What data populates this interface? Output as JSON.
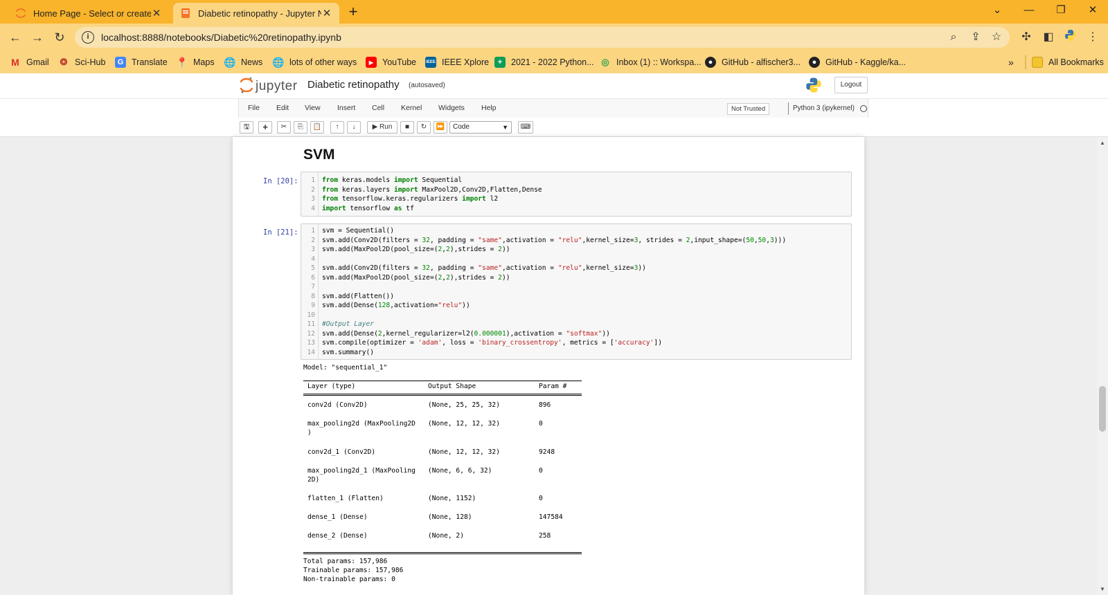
{
  "browser": {
    "tabs": [
      {
        "title": "Home Page - Select or create a n",
        "close": "✕"
      },
      {
        "title": "Diabetic retinopathy - Jupyter N",
        "close": "✕"
      }
    ],
    "new_tab": "+",
    "url": "localhost:8888/notebooks/Diabetic%20retinopathy.ipynb",
    "bookmarks": [
      {
        "label": "Gmail"
      },
      {
        "label": "Sci-Hub"
      },
      {
        "label": "Translate"
      },
      {
        "label": "Maps"
      },
      {
        "label": "News"
      },
      {
        "label": "lots of other ways"
      },
      {
        "label": "YouTube"
      },
      {
        "label": "IEEE Xplore"
      },
      {
        "label": "2021 - 2022 Python..."
      },
      {
        "label": "Inbox (1) :: Workspa..."
      },
      {
        "label": "GitHub - alfischer3..."
      },
      {
        "label": "GitHub - Kaggle/ka..."
      }
    ],
    "more_bookmarks": "»",
    "all_bookmarks": "All Bookmarks"
  },
  "jupyter": {
    "logo_text": "jupyter",
    "notebook_name": "Diabetic retinopathy",
    "autosave": "(autosaved)",
    "logout": "Logout",
    "menu": [
      "File",
      "Edit",
      "View",
      "Insert",
      "Cell",
      "Kernel",
      "Widgets",
      "Help"
    ],
    "trust": "Not Trusted",
    "kernel": "Python 3 (ipykernel)",
    "toolbar": {
      "run": "▶ Run",
      "cell_type": "Code"
    }
  },
  "notebook": {
    "heading": "SVM",
    "cell1": {
      "prompt": "In [20]:",
      "lines": [
        "from keras.models import Sequential",
        "from keras.layers import MaxPool2D,Conv2D,Flatten,Dense",
        "from tensorflow.keras.regularizers import l2",
        "import tensorflow as tf"
      ]
    },
    "cell2": {
      "prompt": "In [21]:",
      "lines": [
        "svm = Sequential()",
        "svm.add(Conv2D(filters = 32, padding = \"same\",activation = \"relu\",kernel_size=3, strides = 2,input_shape=(50,50,3)))",
        "svm.add(MaxPool2D(pool_size=(2,2),strides = 2))",
        "",
        "svm.add(Conv2D(filters = 32, padding = \"same\",activation = \"relu\",kernel_size=3))",
        "svm.add(MaxPool2D(pool_size=(2,2),strides = 2))",
        "",
        "svm.add(Flatten())",
        "svm.add(Dense(128,activation=\"relu\"))",
        "",
        "#Output Layer",
        "svm.add(Dense(2,kernel_regularizer=l2(0.000001),activation = \"softmax\"))",
        "svm.compile(optimizer = 'adam', loss = 'binary_crossentropy', metrics = ['accuracy'])",
        "svm.summary()"
      ]
    },
    "output": {
      "model_line": "Model: \"sequential_1\"",
      "header": {
        "layer": "Layer (type)",
        "shape": "Output Shape",
        "params": "Param #"
      },
      "rows": [
        {
          "layer": "conv2d (Conv2D)",
          "layer2": "",
          "shape": "(None, 25, 25, 32)",
          "params": "896"
        },
        {
          "layer": "max_pooling2d (MaxPooling2D",
          "layer2": ")",
          "shape": "(None, 12, 12, 32)",
          "params": "0"
        },
        {
          "layer": "conv2d_1 (Conv2D)",
          "layer2": "",
          "shape": "(None, 12, 12, 32)",
          "params": "9248"
        },
        {
          "layer": "max_pooling2d_1 (MaxPooling",
          "layer2": "2D)",
          "shape": "(None, 6, 6, 32)",
          "params": "0"
        },
        {
          "layer": "flatten_1 (Flatten)",
          "layer2": "",
          "shape": "(None, 1152)",
          "params": "0"
        },
        {
          "layer": "dense_1 (Dense)",
          "layer2": "",
          "shape": "(None, 128)",
          "params": "147584"
        },
        {
          "layer": "dense_2 (Dense)",
          "layer2": "",
          "shape": "(None, 2)",
          "params": "258"
        }
      ],
      "total": "Total params: 157,986",
      "trainable": "Trainable params: 157,986",
      "non_trainable": "Non-trainable params: 0"
    }
  }
}
